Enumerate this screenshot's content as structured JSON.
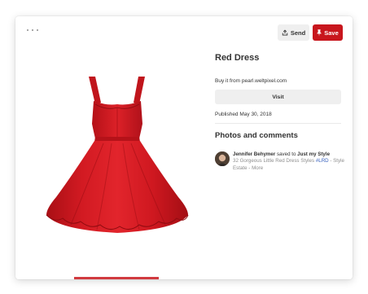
{
  "header": {
    "send_label": "Send",
    "save_label": "Save"
  },
  "pin": {
    "title": "Red Dress",
    "buy_text": "Buy it from pearl.weltpixel.com",
    "visit_label": "Visit",
    "published": "Published May 30, 2018"
  },
  "comments": {
    "heading": "Photos and comments",
    "items": [
      {
        "user": "Jennifer Behymer",
        "action": "saved to",
        "board": "Just my Style",
        "desc_before": "32 Gorgeous Little Red Dress Styles",
        "hashtag": "#LRD",
        "desc_after": "- Style Estate -",
        "more": "More"
      }
    ]
  },
  "colors": {
    "save_red": "#c8161d",
    "dress_red": "#c8141c",
    "button_gray": "#efefef",
    "text_dark": "#333333",
    "text_muted": "#8e8e8e",
    "link_blue": "#355fbc"
  },
  "icons": {
    "more": "more-dots-icon",
    "send": "share-upload-icon",
    "save": "pin-icon"
  }
}
